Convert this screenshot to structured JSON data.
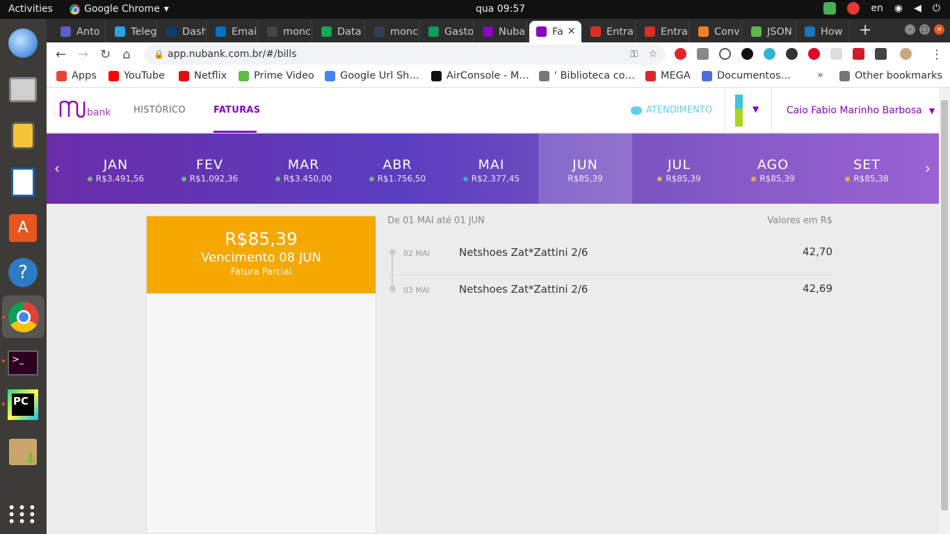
{
  "topbar": {
    "activities": "Activities",
    "app": "Google Chrome",
    "clock": "qua 09:57",
    "lang": "en"
  },
  "tabs": [
    {
      "label": "Anto",
      "color": "#5b5fc7"
    },
    {
      "label": "Teleg",
      "color": "#2aa3e0"
    },
    {
      "label": "Dashl",
      "color": "#0e3d6b"
    },
    {
      "label": "Email",
      "color": "#0072c6"
    },
    {
      "label": "monc",
      "color": "#444444"
    },
    {
      "label": "Data",
      "color": "#13aa52"
    },
    {
      "label": "monc",
      "color": "#333c55"
    },
    {
      "label": "Gasto",
      "color": "#0f9d58"
    },
    {
      "label": "Nuba",
      "color": "#8a05be"
    },
    {
      "label": "Fa",
      "color": "#8a05be"
    },
    {
      "label": "Entra",
      "color": "#d93025"
    },
    {
      "label": "Entra",
      "color": "#d93025"
    },
    {
      "label": "Conv",
      "color": "#f48024"
    },
    {
      "label": "JSON",
      "color": "#5bb947"
    },
    {
      "label": "How",
      "color": "#1e73be"
    }
  ],
  "url": "app.nubank.com.br/#/bills",
  "bookmarks": [
    {
      "label": "Apps",
      "color": "#e94335"
    },
    {
      "label": "YouTube",
      "color": "#ff0000"
    },
    {
      "label": "Netflix",
      "color": "#e50914"
    },
    {
      "label": "Prime Video",
      "color": "#5fbb46"
    },
    {
      "label": "Google Url Sh…",
      "color": "#4285f4"
    },
    {
      "label": "AirConsole - M…",
      "color": "#111111"
    },
    {
      "label": "' Biblioteca co…",
      "color": "#777777"
    },
    {
      "label": "MEGA",
      "color": "#d9272e"
    },
    {
      "label": "Documentos…",
      "color": "#4a6ee0"
    }
  ],
  "other_bookmarks": "Other bookmarks",
  "nav": {
    "logo": "bank",
    "historico": "HISTÓRICO",
    "faturas": "FATURAS",
    "atendimento": "ATENDIMENTO",
    "user": "Caio Fabio Marinho Barbosa"
  },
  "months": [
    {
      "name": "JAN",
      "value": "R$3.491,56",
      "dot": "#7bc67e"
    },
    {
      "name": "FEV",
      "value": "R$1.092,36",
      "dot": "#7bc67e"
    },
    {
      "name": "MAR",
      "value": "R$3.450,00",
      "dot": "#7bc67e"
    },
    {
      "name": "ABR",
      "value": "R$1.756,50",
      "dot": "#7bc67e"
    },
    {
      "name": "MAI",
      "value": "R$2.377,45",
      "dot": "#3bb2d9"
    },
    {
      "name": "JUN",
      "value": "R$85,39",
      "dot": ""
    },
    {
      "name": "JUL",
      "value": "R$85,39",
      "dot": "#f5b942"
    },
    {
      "name": "AGO",
      "value": "R$85,39",
      "dot": "#f5b942"
    },
    {
      "name": "SET",
      "value": "R$85,38",
      "dot": "#f5b942"
    }
  ],
  "bill": {
    "amount": "R$85,39",
    "due": "Vencimento 08 JUN",
    "status": "Fatura Parcial"
  },
  "detail": {
    "period": "De 01 MAI até 01 JUN",
    "units": "Valores em R$",
    "items": [
      {
        "date": "02 MAI",
        "name": "Netshoes Zat*Zattini 2/6",
        "value": "42,70"
      },
      {
        "date": "03 MAI",
        "name": "Netshoes Zat*Zattini 2/6",
        "value": "42,69"
      }
    ]
  }
}
